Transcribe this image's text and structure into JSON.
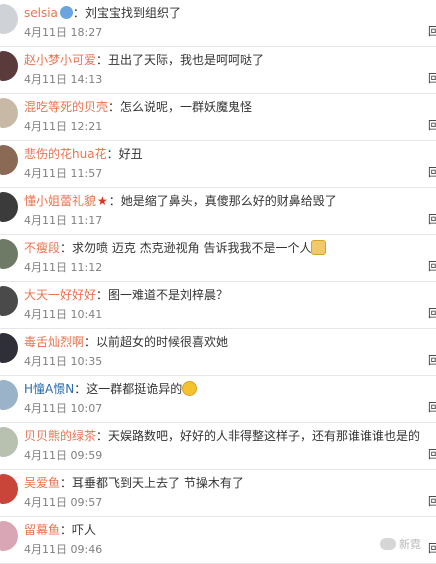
{
  "reply_label": "回复",
  "watermark_text": "新霓",
  "comments": [
    {
      "user": "selsia",
      "text": "刘宝宝找到组织了",
      "date": "4月11日",
      "time": "18:27",
      "avatar_color": "#cfd3d8",
      "badge": "vip"
    },
    {
      "user": "赵小梦小可爱",
      "text": "丑出了天际，我也是呵呵哒了",
      "date": "4月11日",
      "time": "14:13",
      "avatar_color": "#5a3a3a"
    },
    {
      "user": "混吃等死的贝壳",
      "text": "怎么说呢，一群妖魔鬼怪",
      "date": "4月11日",
      "time": "12:21",
      "avatar_color": "#c8b9a6"
    },
    {
      "user": "悲伤的花hua花",
      "text": "好丑",
      "date": "4月11日",
      "time": "11:57",
      "avatar_color": "#8a6a55"
    },
    {
      "user": "懂小姐蕾礼貌",
      "text": "她是缩了鼻头，真傻那么好的财鼻给毁了",
      "date": "4月11日",
      "time": "11:17",
      "avatar_color": "#3b3b3b",
      "badge": "star"
    },
    {
      "user": "不瘦段",
      "text": "求勿喷 迈克 杰克逊视角 告诉我我不是一个人",
      "date": "4月11日",
      "time": "11:12",
      "avatar_color": "#6f7a66",
      "emoji": "dog-emoji"
    },
    {
      "user": "大天一好好好",
      "text": "图一难道不是刘梓晨？",
      "date": "4月11日",
      "time": "10:41",
      "avatar_color": "#4a4a4a"
    },
    {
      "user": "毒舌灿烈啊",
      "text": "以前超女的时候很喜欢她",
      "date": "4月11日",
      "time": "10:35",
      "avatar_color": "#2f2f3a"
    },
    {
      "user": "H憧A憬N",
      "text": "这一群都挺诡异的",
      "date": "4月11日",
      "time": "10:07",
      "avatar_color": "#9bb3c8",
      "user_color": "blue",
      "emoji": "laugh-emoji"
    },
    {
      "user": "贝贝熊的绿茶",
      "text": "天娱路数吧，好好的人非得整这样子，还有那谁谁谁也是的",
      "date": "4月11日",
      "time": "09:59",
      "avatar_color": "#b8c0b0"
    },
    {
      "user": "吴爱鱼",
      "text": "耳垂都飞到天上去了 节操木有了",
      "date": "4月11日",
      "time": "09:57",
      "avatar_color": "#c9453a"
    },
    {
      "user": "留幕鱼",
      "text": "吓人",
      "date": "4月11日",
      "time": "09:46",
      "avatar_color": "#d9a6b5"
    }
  ]
}
